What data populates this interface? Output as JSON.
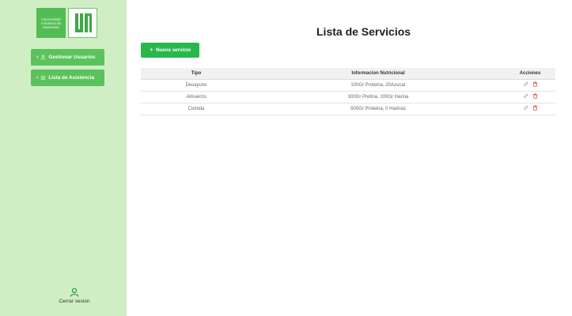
{
  "sidebar": {
    "logo": {
      "text_lines": [
        "Universidad",
        "Industrial de",
        "Santander"
      ],
      "mark": "UIS"
    },
    "nav": [
      {
        "label": "Gestionar Usuarios",
        "icon": "user-icon"
      },
      {
        "label": "Lista de Asistencia",
        "icon": "list-icon"
      }
    ],
    "logout_label": "Cerrar sesion"
  },
  "main": {
    "title": "Lista de Servicios",
    "new_button_label": "Nuevo servicio",
    "table": {
      "headers": [
        "Tipo",
        "Informacion Nutricional",
        "Acciones"
      ],
      "rows": [
        {
          "tipo": "Desayuno",
          "info": "100Gr Proteina, 20Azucar"
        },
        {
          "tipo": "Almuerzo",
          "info": "300Gr Pretina, 100Gr Harina"
        },
        {
          "tipo": "Comida",
          "info": "500Gr Proteina, 0 Harinas"
        }
      ]
    }
  },
  "colors": {
    "sidebar_bg": "#cfeec4",
    "nav_button": "#5bc25c",
    "primary_button": "#28b84a",
    "edit_icon": "#9a9a9a",
    "delete_icon": "#d9352b"
  }
}
